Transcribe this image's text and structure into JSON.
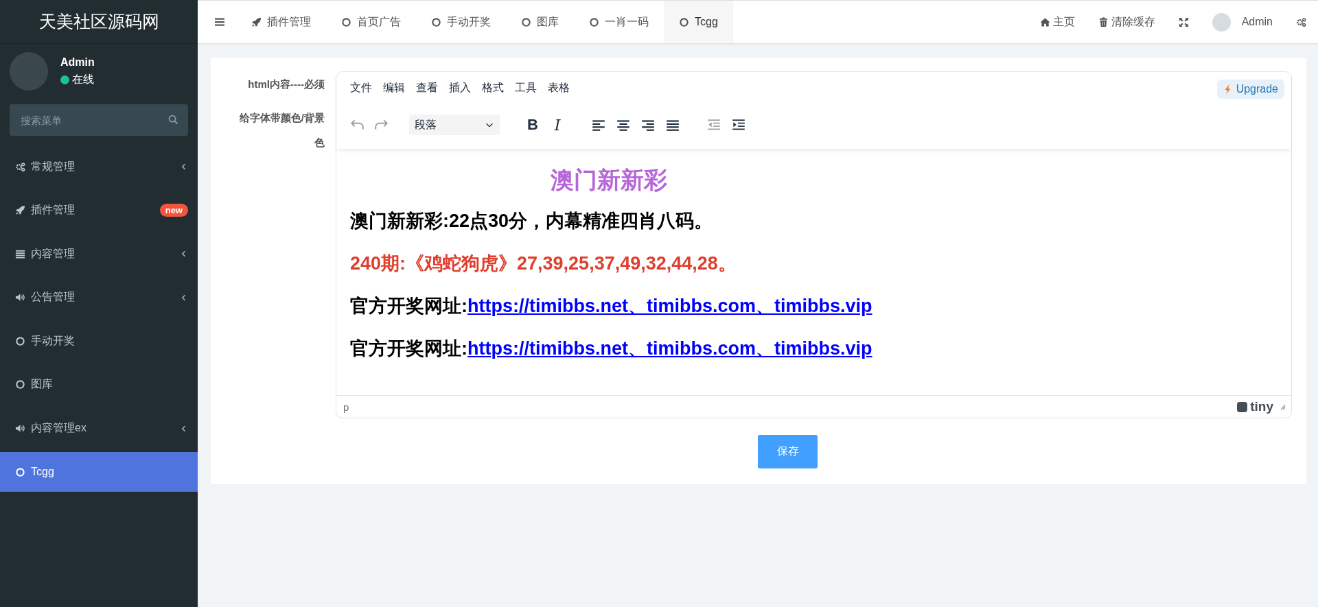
{
  "sidebar": {
    "logo": "天美社区源码网",
    "user": {
      "name": "Admin",
      "status": "在线"
    },
    "search": {
      "placeholder": "搜索菜单"
    },
    "items": [
      {
        "kind": "gears",
        "label": "常规管理",
        "expandable": true,
        "selected": false
      },
      {
        "kind": "rocket",
        "label": "插件管理",
        "badge": "new",
        "expandable": false,
        "selected": false
      },
      {
        "kind": "list",
        "label": "内容管理",
        "expandable": true,
        "selected": false
      },
      {
        "kind": "volume",
        "label": "公告管理",
        "expandable": true,
        "selected": false
      },
      {
        "kind": "circle",
        "label": "手动开奖",
        "expandable": false,
        "selected": false
      },
      {
        "kind": "circle",
        "label": "图库",
        "expandable": false,
        "selected": false
      },
      {
        "kind": "volume",
        "label": "内容管理ex",
        "expandable": true,
        "selected": false
      },
      {
        "kind": "circle",
        "label": "Tcgg",
        "expandable": false,
        "selected": true
      }
    ]
  },
  "topbar": {
    "tabs": [
      {
        "kind": "rocket",
        "label": "插件管理",
        "selected": false
      },
      {
        "kind": "circle",
        "label": "首页广告",
        "selected": false
      },
      {
        "kind": "circle",
        "label": "手动开奖",
        "selected": false
      },
      {
        "kind": "circle",
        "label": "图库",
        "selected": false
      },
      {
        "kind": "circle",
        "label": "一肖一码",
        "selected": false
      },
      {
        "kind": "circle",
        "label": "Tcgg",
        "selected": true
      }
    ],
    "actions": [
      {
        "kind": "home",
        "label": "主页"
      },
      {
        "kind": "trash",
        "label": "清除缓存"
      },
      {
        "kind": "expand"
      },
      {
        "kind": "avatar",
        "label": "Admin"
      },
      {
        "kind": "gears"
      }
    ]
  },
  "form": {
    "labels": [
      "html内容----必须",
      "给字体带颜色/背景色"
    ],
    "editor": {
      "menu": [
        "文件",
        "编辑",
        "查看",
        "插入",
        "格式",
        "工具",
        "表格"
      ],
      "upgrade": "Upgrade",
      "block_format": "段落",
      "toolbar": [
        {
          "kind": "undo",
          "disabled": true
        },
        {
          "kind": "redo",
          "disabled": true
        },
        {
          "kind": "select"
        },
        {
          "kind": "bold",
          "label": "B"
        },
        {
          "kind": "italic",
          "label": "I"
        },
        {
          "kind": "alignleft"
        },
        {
          "kind": "aligncenter"
        },
        {
          "kind": "alignright"
        },
        {
          "kind": "alignjustify"
        },
        {
          "kind": "outdent",
          "disabled": true
        },
        {
          "kind": "indent",
          "disabled": false
        }
      ],
      "content": [
        {
          "kind": "heading",
          "text": "澳门新新彩",
          "color": "#b565d8"
        },
        {
          "kind": "para",
          "text": "澳门新新彩:22点30分，内幕精准四肖八码。",
          "color": "#000000"
        },
        {
          "kind": "para",
          "text": "240期:《鸡蛇狗虎》27,39,25,37,49,32,44,28。",
          "color": "#e03e2d"
        },
        {
          "kind": "link",
          "text": "官方开奖网址:",
          "link": "https://timibbs.net、timibbs.com、timibbs.vip"
        },
        {
          "kind": "link",
          "text": "官方开奖网址:",
          "link": "https://timibbs.net、timibbs.com、timibbs.vip"
        }
      ],
      "path": "p",
      "brand": "tiny"
    },
    "save": "保存"
  }
}
